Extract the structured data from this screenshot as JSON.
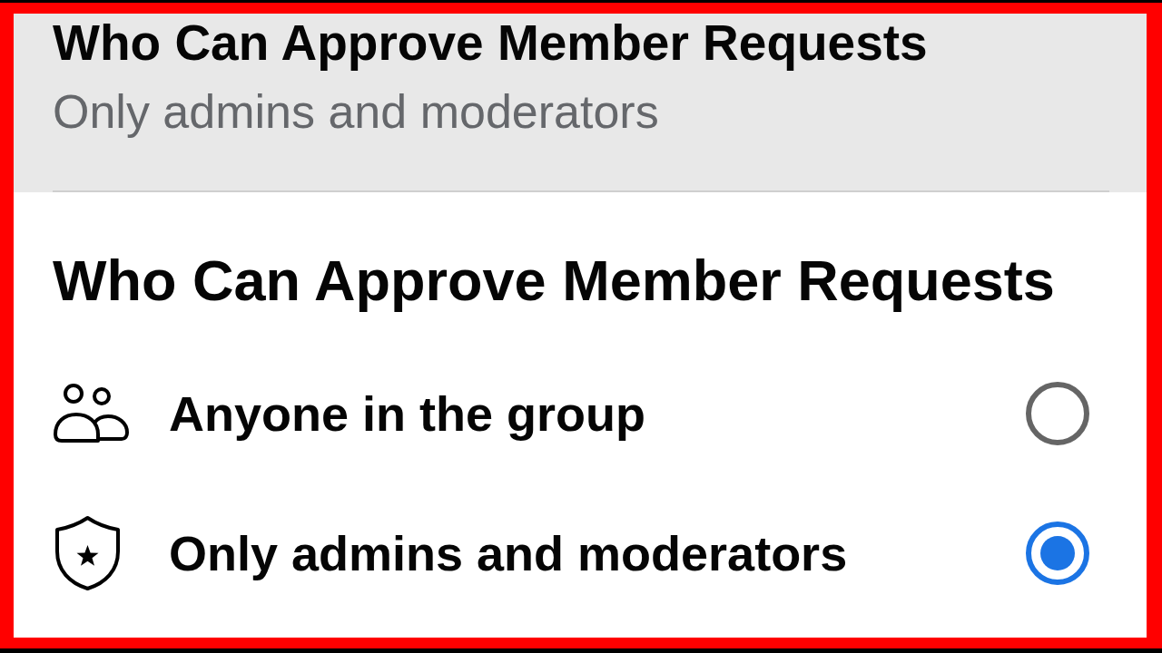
{
  "header": {
    "title": "Who Can Approve Member Requests",
    "value": "Only admins and moderators"
  },
  "sheet": {
    "title": "Who Can Approve Member Requests",
    "options": [
      {
        "kind": "people",
        "label": "Anyone in the group",
        "selected": false
      },
      {
        "kind": "shield",
        "label": "Only admins and moderators",
        "selected": true
      }
    ]
  }
}
